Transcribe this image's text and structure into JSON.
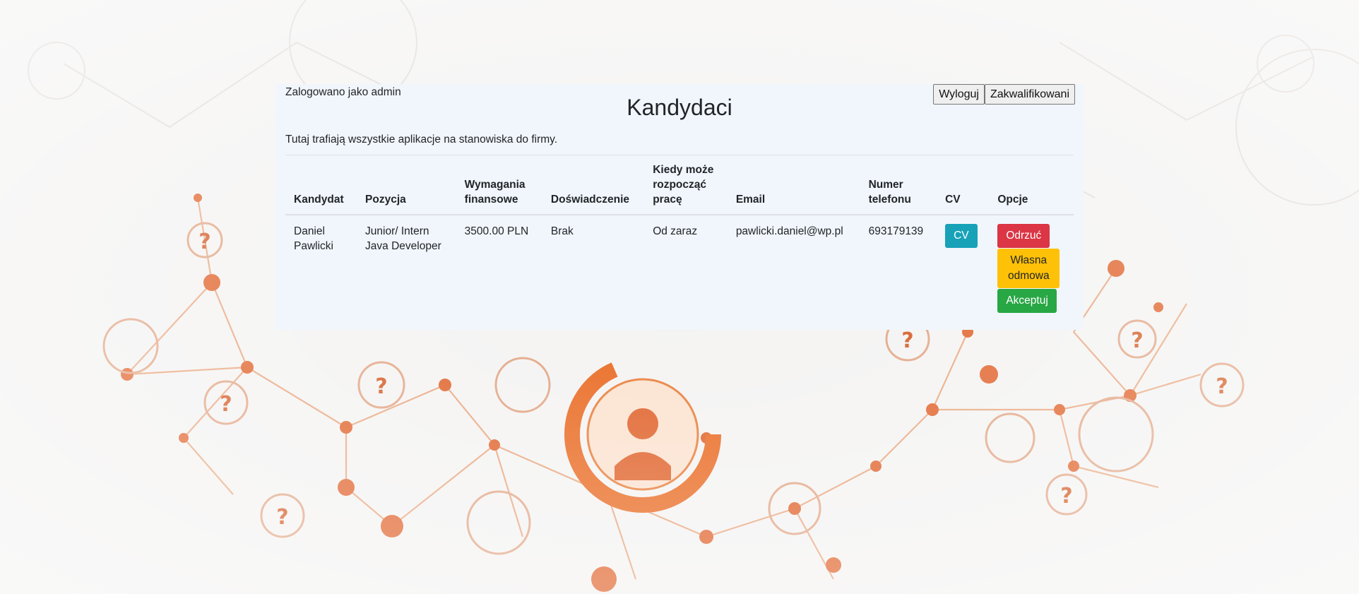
{
  "header": {
    "logged_in_text": "Zalogowano jako admin",
    "title": "Kandydaci",
    "logout_label": "Wyloguj",
    "qualified_label": "Zakwalifikowani"
  },
  "intro": "Tutaj trafiają wszystkie aplikacje na stanowiska do firmy.",
  "table": {
    "columns": {
      "candidate": "Kandydat",
      "position": "Pozycja",
      "salary_line1": "Wymagania",
      "salary_line2": "finansowe",
      "experience": "Doświadczenie",
      "start_line1": "Kiedy może",
      "start_line2": "rozpocząć",
      "start_line3": "pracę",
      "email": "Email",
      "phone_line1": "Numer",
      "phone_line2": "telefonu",
      "cv": "CV",
      "options": "Opcje"
    },
    "rows": [
      {
        "name_line1": "Daniel",
        "name_line2": "Pawlicki",
        "position_line1": "Junior/ Intern",
        "position_line2": "Java Developer",
        "salary": "3500.00 PLN",
        "experience": "Brak",
        "start": "Od zaraz",
        "email": "pawlicki.daniel@wp.pl",
        "phone": "693179139",
        "cv_label": "CV",
        "reject_label": "Odrzuć",
        "own_reject_line1": "Własna",
        "own_reject_line2": "odmowa",
        "accept_label": "Akceptuj"
      }
    ]
  },
  "colors": {
    "panel": "#f1f6fc",
    "danger": "#dc3545",
    "warning": "#ffc107",
    "success": "#28a745",
    "info": "#17a2b8",
    "accent_orange": "#e8622a"
  }
}
